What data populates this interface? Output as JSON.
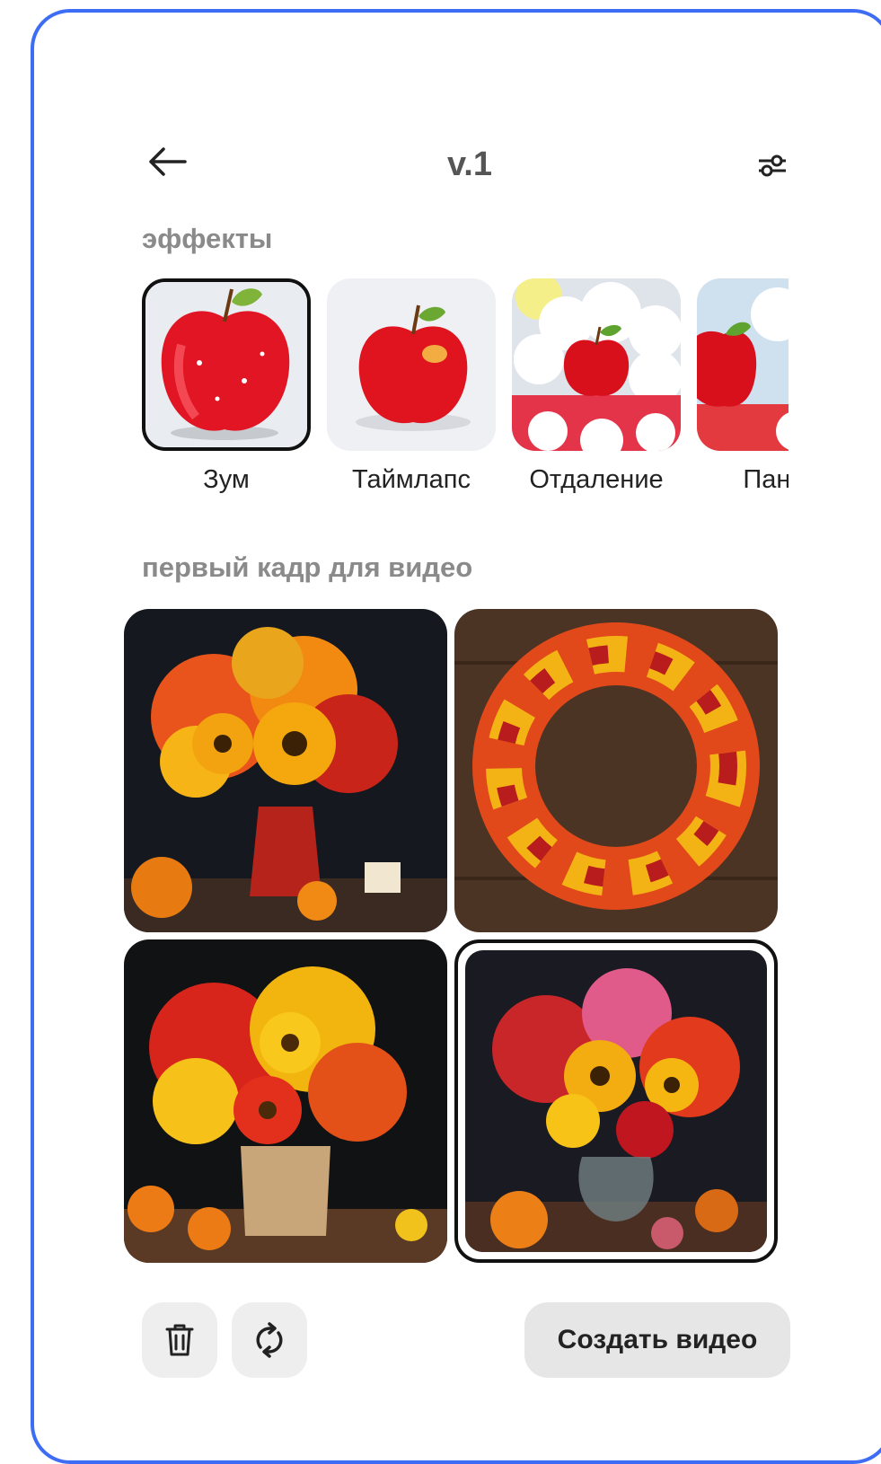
{
  "header": {
    "title": "v.1",
    "back_icon": "arrow-left-icon",
    "settings_icon": "sliders-icon"
  },
  "effects": {
    "section_label": "эффекты",
    "items": [
      {
        "label": "Зум",
        "selected": true
      },
      {
        "label": "Таймлапс",
        "selected": false
      },
      {
        "label": "Отдаление",
        "selected": false
      },
      {
        "label": "Панор",
        "selected": false
      }
    ]
  },
  "first_frame": {
    "section_label": "первый кадр для видео",
    "images": [
      {
        "subject": "sunflower bouquet in red vase",
        "selected": false
      },
      {
        "subject": "autumn flower wreath on wood",
        "selected": false
      },
      {
        "subject": "bouquet in paper bag",
        "selected": false
      },
      {
        "subject": "bouquet in glass vase",
        "selected": true
      }
    ]
  },
  "actions": {
    "delete_icon": "trash-icon",
    "regenerate_icon": "refresh-icon",
    "create_label": "Создать видео"
  },
  "colors": {
    "frame_border": "#3d6df5",
    "selected_border": "#111111",
    "button_bg": "#e6e6e6"
  }
}
